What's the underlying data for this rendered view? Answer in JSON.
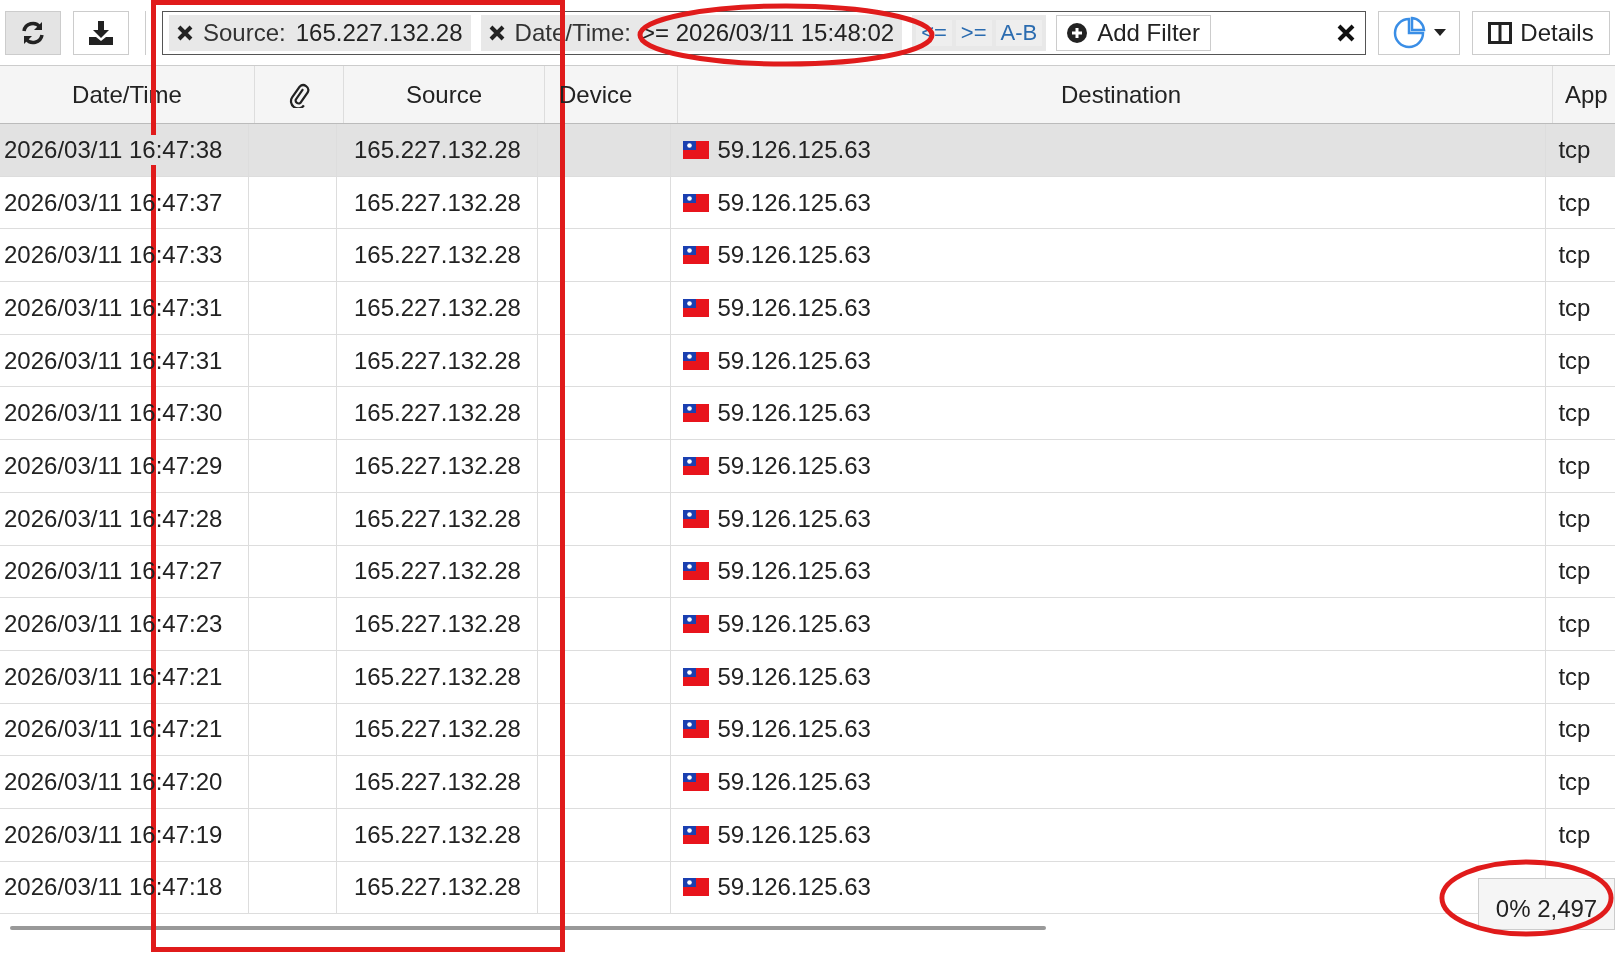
{
  "toolbar": {
    "refresh_pressed": true
  },
  "filters": [
    {
      "field": "Source:",
      "value": "165.227.132.28"
    },
    {
      "field": "Date/Time:",
      "value": ">= 2026/03/11 15:48:02",
      "circled": true
    }
  ],
  "operators": [
    "<=",
    ">=",
    "A-B"
  ],
  "add_filter": {
    "label": "Add Filter"
  },
  "details": {
    "label": "Details"
  },
  "table": {
    "columns": [
      "Date/Time",
      "",
      "Source",
      "Device",
      "Destination",
      "App"
    ],
    "source_column_boxed": true,
    "rows": [
      {
        "time": "2026/03/11 16:47:38",
        "source": "165.227.132.28",
        "destination": "59.126.125.63",
        "app": "tcp",
        "selected": true
      },
      {
        "time": "2026/03/11 16:47:37",
        "source": "165.227.132.28",
        "destination": "59.126.125.63",
        "app": "tcp",
        "selected": false
      },
      {
        "time": "2026/03/11 16:47:33",
        "source": "165.227.132.28",
        "destination": "59.126.125.63",
        "app": "tcp",
        "selected": false
      },
      {
        "time": "2026/03/11 16:47:31",
        "source": "165.227.132.28",
        "destination": "59.126.125.63",
        "app": "tcp",
        "selected": false
      },
      {
        "time": "2026/03/11 16:47:31",
        "source": "165.227.132.28",
        "destination": "59.126.125.63",
        "app": "tcp",
        "selected": false
      },
      {
        "time": "2026/03/11 16:47:30",
        "source": "165.227.132.28",
        "destination": "59.126.125.63",
        "app": "tcp",
        "selected": false
      },
      {
        "time": "2026/03/11 16:47:29",
        "source": "165.227.132.28",
        "destination": "59.126.125.63",
        "app": "tcp",
        "selected": false
      },
      {
        "time": "2026/03/11 16:47:28",
        "source": "165.227.132.28",
        "destination": "59.126.125.63",
        "app": "tcp",
        "selected": false
      },
      {
        "time": "2026/03/11 16:47:27",
        "source": "165.227.132.28",
        "destination": "59.126.125.63",
        "app": "tcp",
        "selected": false
      },
      {
        "time": "2026/03/11 16:47:23",
        "source": "165.227.132.28",
        "destination": "59.126.125.63",
        "app": "tcp",
        "selected": false
      },
      {
        "time": "2026/03/11 16:47:21",
        "source": "165.227.132.28",
        "destination": "59.126.125.63",
        "app": "tcp",
        "selected": false
      },
      {
        "time": "2026/03/11 16:47:21",
        "source": "165.227.132.28",
        "destination": "59.126.125.63",
        "app": "tcp",
        "selected": false
      },
      {
        "time": "2026/03/11 16:47:20",
        "source": "165.227.132.28",
        "destination": "59.126.125.63",
        "app": "tcp",
        "selected": false
      },
      {
        "time": "2026/03/11 16:47:19",
        "source": "165.227.132.28",
        "destination": "59.126.125.63",
        "app": "tcp",
        "selected": false
      },
      {
        "time": "2026/03/11 16:47:18",
        "source": "165.227.132.28",
        "destination": "59.126.125.63",
        "selected": false
      }
    ]
  },
  "count_badge": {
    "text": "0% 2,497",
    "circled": true
  }
}
